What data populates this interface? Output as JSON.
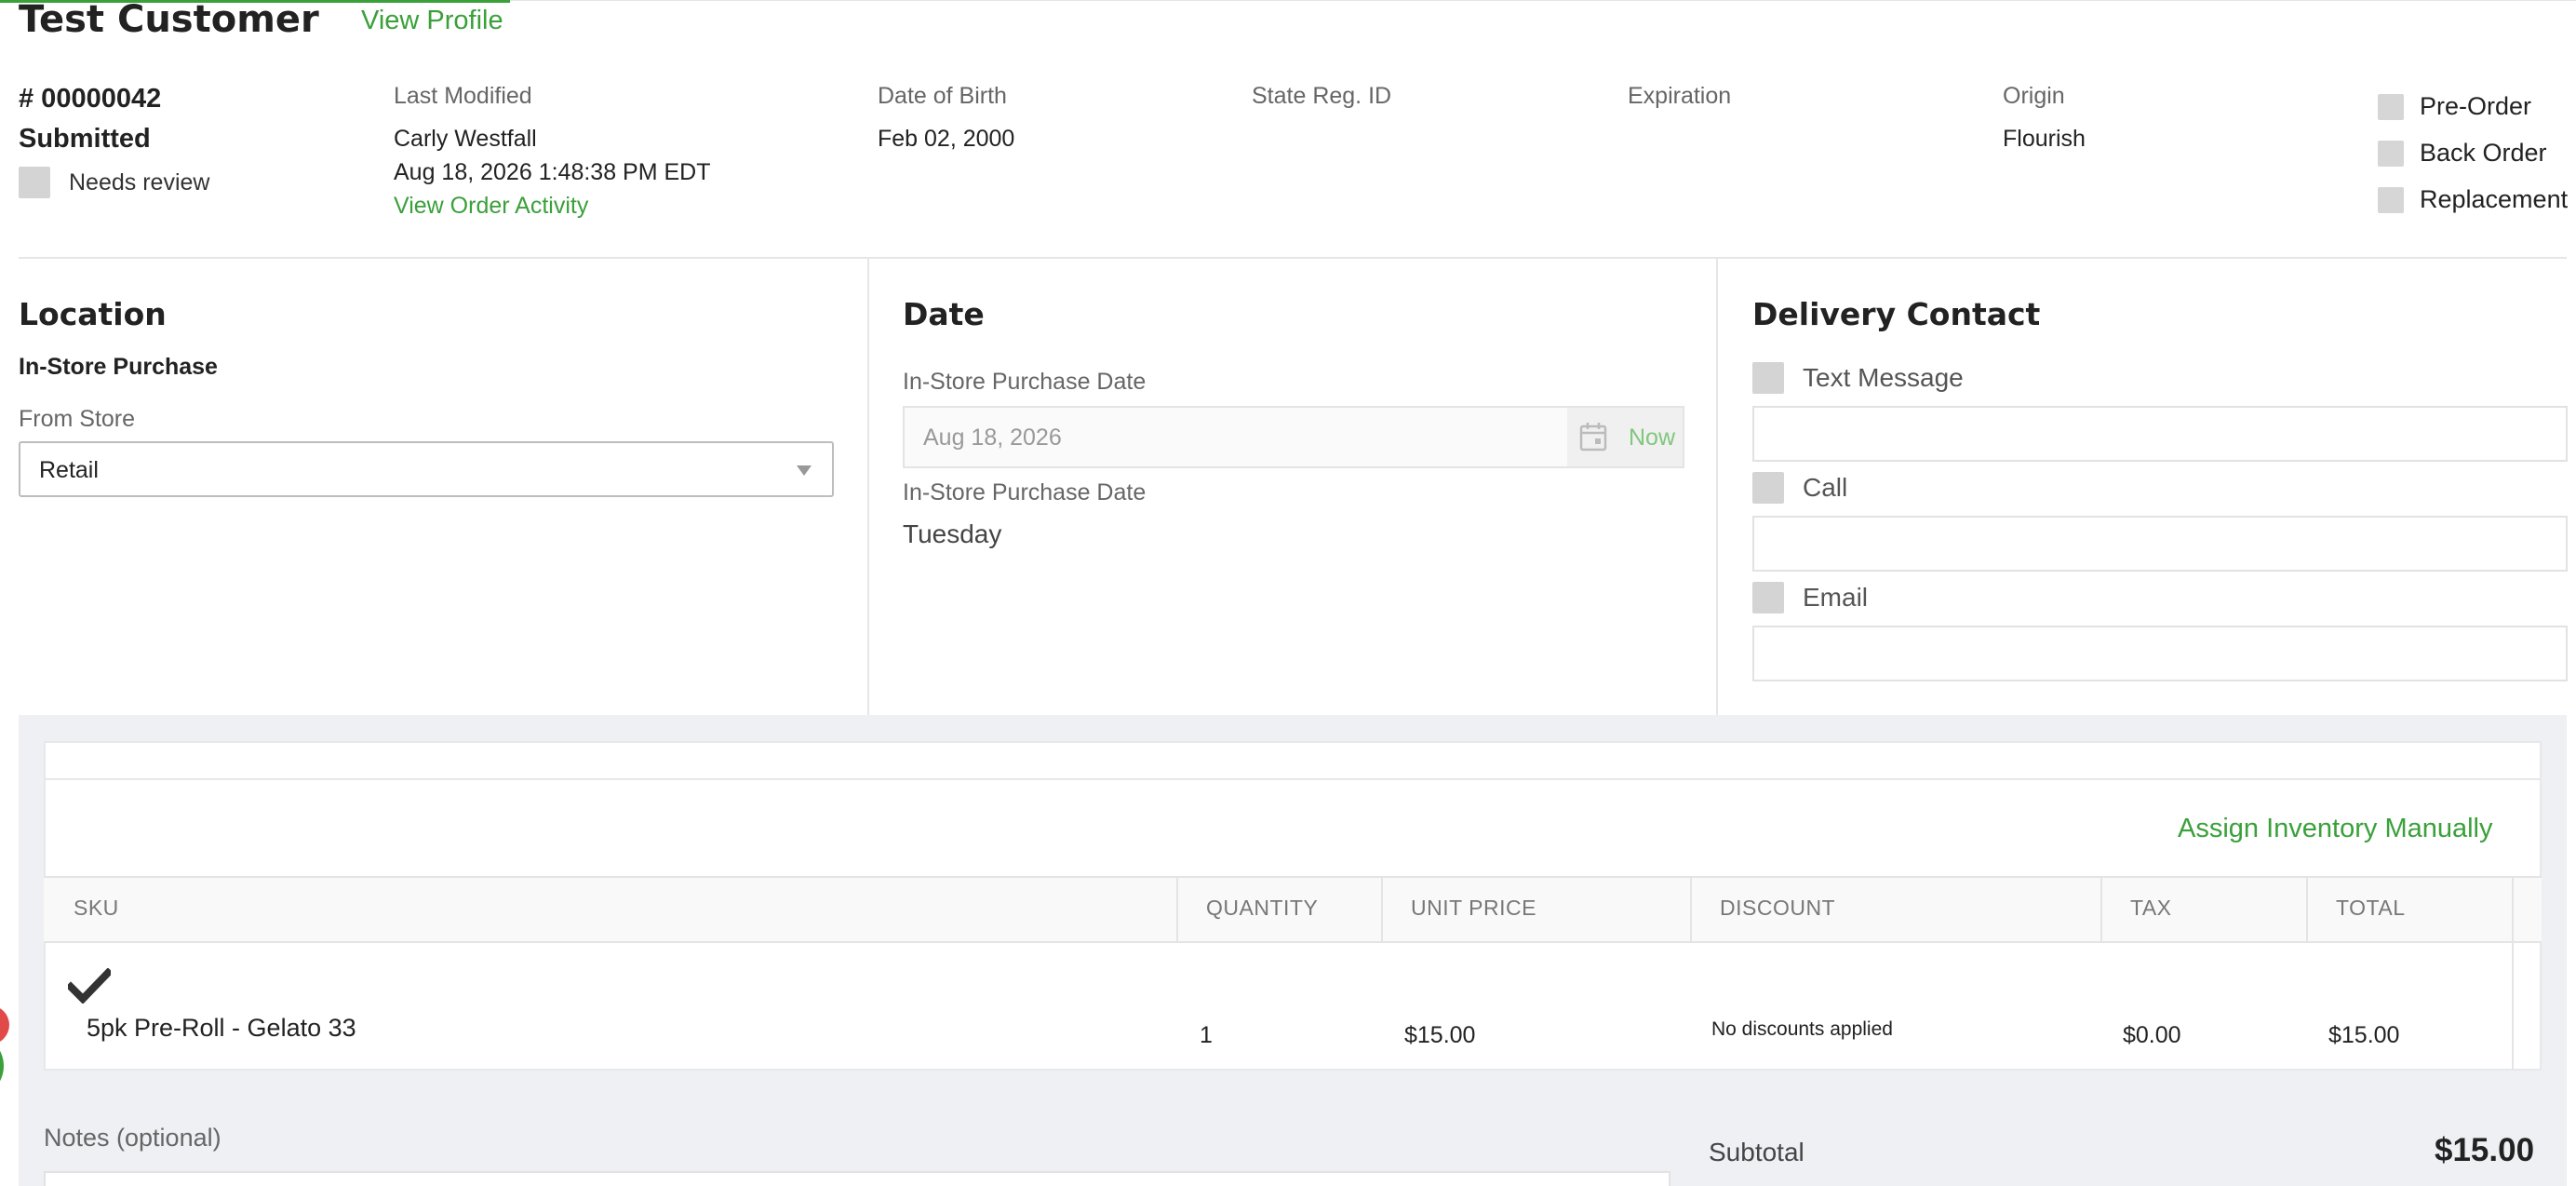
{
  "header": {
    "customer_name": "Test Customer",
    "view_profile": "View Profile"
  },
  "order": {
    "number": "# 00000042",
    "status": "Submitted",
    "needs_review": "Needs review"
  },
  "meta": {
    "last_modified_label": "Last Modified",
    "last_modified_by": "Carly Westfall",
    "last_modified_at": "Aug 18, 2026 1:48:38 PM EDT",
    "view_activity": "View Order Activity",
    "dob_label": "Date of Birth",
    "dob_value": "Feb 02, 2000",
    "state_reg_label": "State Reg. ID",
    "expiration_label": "Expiration",
    "origin_label": "Origin",
    "origin_value": "Flourish"
  },
  "order_type": {
    "pre_order": "Pre-Order",
    "back_order": "Back Order",
    "replacement": "Replacement"
  },
  "location": {
    "title": "Location",
    "purchase_type": "In-Store Purchase",
    "from_store_label": "From Store",
    "store_value": "Retail"
  },
  "date": {
    "title": "Date",
    "purchase_date_label": "In-Store Purchase Date",
    "purchase_date_value": "Aug 18, 2026",
    "now_button": "Now",
    "day_label": "In-Store Purchase Date",
    "day_value": "Tuesday"
  },
  "delivery": {
    "title": "Delivery Contact",
    "text_message": "Text Message",
    "call": "Call",
    "email": "Email"
  },
  "items": {
    "assign_inventory": "Assign Inventory Manually",
    "columns": {
      "sku": "SKU",
      "quantity": "QUANTITY",
      "unit_price": "UNIT PRICE",
      "discount": "DISCOUNT",
      "tax": "TAX",
      "total": "TOTAL"
    },
    "rows": [
      {
        "sku": "5pk Pre-Roll - Gelato 33",
        "quantity": "1",
        "unit_price": "$15.00",
        "discount": "No discounts applied",
        "tax": "$0.00",
        "total": "$15.00"
      }
    ]
  },
  "footer": {
    "notes_label": "Notes (optional)",
    "subtotal_label": "Subtotal",
    "subtotal_value": "$15.00"
  },
  "colors": {
    "accent": "#3aa03a",
    "panel_bg": "#eef0f4"
  },
  "icons": [
    "check-icon",
    "calendar-icon",
    "dropdown-caret-icon"
  ]
}
